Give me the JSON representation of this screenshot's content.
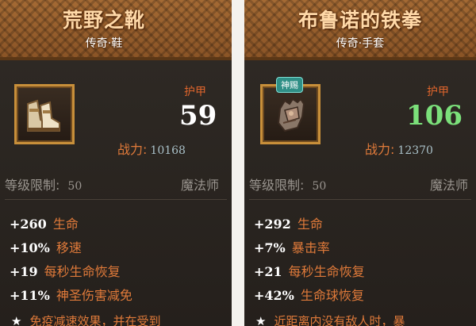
{
  "items": [
    {
      "title": "荒野之靴",
      "subtitle": "传奇·鞋",
      "badge": "",
      "icon": "boots-icon",
      "armor_label": "护甲",
      "armor_value": "59",
      "armor_color": "#ffffff",
      "power_label": "战力:",
      "power_value": "10168",
      "level_label": "等级限制:",
      "level_value": "50",
      "class": "魔法师",
      "stats": [
        {
          "value": "+260",
          "label": "生命"
        },
        {
          "value": "+10%",
          "label": "移速"
        },
        {
          "value": "+19",
          "label": "每秒生命恢复"
        },
        {
          "value": "+11%",
          "label": "神圣伤害减免"
        }
      ],
      "footnote": "免疫减速效果，并在受到"
    },
    {
      "title": "布鲁诺的铁拳",
      "subtitle": "传奇·手套",
      "badge": "神赐",
      "icon": "gauntlet-icon",
      "armor_label": "护甲",
      "armor_value": "106",
      "armor_color": "#7be07a",
      "power_label": "战力:",
      "power_value": "12370",
      "level_label": "等级限制:",
      "level_value": "50",
      "class": "魔法师",
      "stats": [
        {
          "value": "+292",
          "label": "生命"
        },
        {
          "value": "+7%",
          "label": "暴击率"
        },
        {
          "value": "+21",
          "label": "每秒生命恢复"
        },
        {
          "value": "+42%",
          "label": "生命球恢复"
        }
      ],
      "footnote": "近距离内没有敌人时，暴"
    }
  ]
}
